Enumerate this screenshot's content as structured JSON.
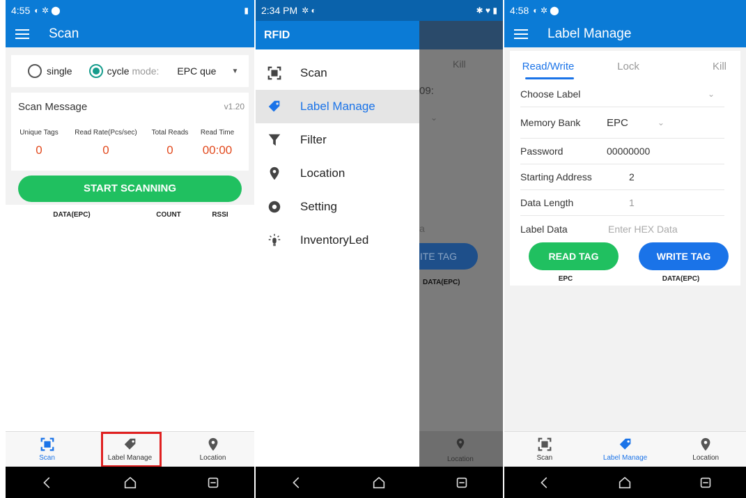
{
  "screen1": {
    "status": {
      "time": "4:55"
    },
    "title": "Scan",
    "radio_single": "single",
    "radio_cycle": "cycle",
    "mode_label": "mode:",
    "mode_value": "EPC que",
    "scan_message": "Scan Message",
    "version": "v1.20",
    "stats": [
      {
        "label": "Unique Tags",
        "value": "0"
      },
      {
        "label": "Read Rate(Pcs/sec)",
        "value": "0"
      },
      {
        "label": "Total Reads",
        "value": "0"
      },
      {
        "label": "Read Time",
        "value": "00:00"
      }
    ],
    "start_button": "START SCANNING",
    "columns": [
      "DATA(EPC)",
      "COUNT",
      "RSSI"
    ]
  },
  "bottom_nav": {
    "scan": "Scan",
    "label_manage": "Label Manage",
    "location": "Location"
  },
  "screen2": {
    "status": {
      "time": "2:34 PM"
    },
    "drawer_title": "RFID",
    "items": [
      {
        "label": "Scan",
        "icon": "scan-icon"
      },
      {
        "label": "Label Manage",
        "icon": "tag-icon"
      },
      {
        "label": "Filter",
        "icon": "filter-icon"
      },
      {
        "label": "Location",
        "icon": "location-icon"
      },
      {
        "label": "Setting",
        "icon": "gear-icon"
      },
      {
        "label": "InventoryLed",
        "icon": "led-icon"
      }
    ],
    "bg_kill": "Kill",
    "bg_value": "09:",
    "bg_letter": "a",
    "bg_button": "RITE TAG",
    "bg_header": "DATA(EPC)",
    "bg_location": "Location"
  },
  "screen3": {
    "status": {
      "time": "4:58"
    },
    "title": "Label Manage",
    "tabs": [
      "Read/Write",
      "Lock",
      "Kill"
    ],
    "rows": [
      {
        "label": "Choose Label",
        "value": ""
      },
      {
        "label": "Memory Bank",
        "value": "EPC"
      },
      {
        "label": "Password",
        "value": "00000000"
      },
      {
        "label": "Starting Address",
        "value": "2"
      },
      {
        "label": "Data Length",
        "value": "1"
      },
      {
        "label": "Label Data",
        "placeholder": "Enter HEX Data"
      }
    ],
    "read_button": "READ TAG",
    "write_button": "WRITE TAG",
    "columns": [
      "EPC",
      "DATA(EPC)"
    ]
  },
  "colors": {
    "primary": "#0b7bd6",
    "accent_blue": "#1a73e8",
    "green": "#20c060",
    "red_value": "#e24a1e",
    "highlight_box": "#e02020"
  }
}
